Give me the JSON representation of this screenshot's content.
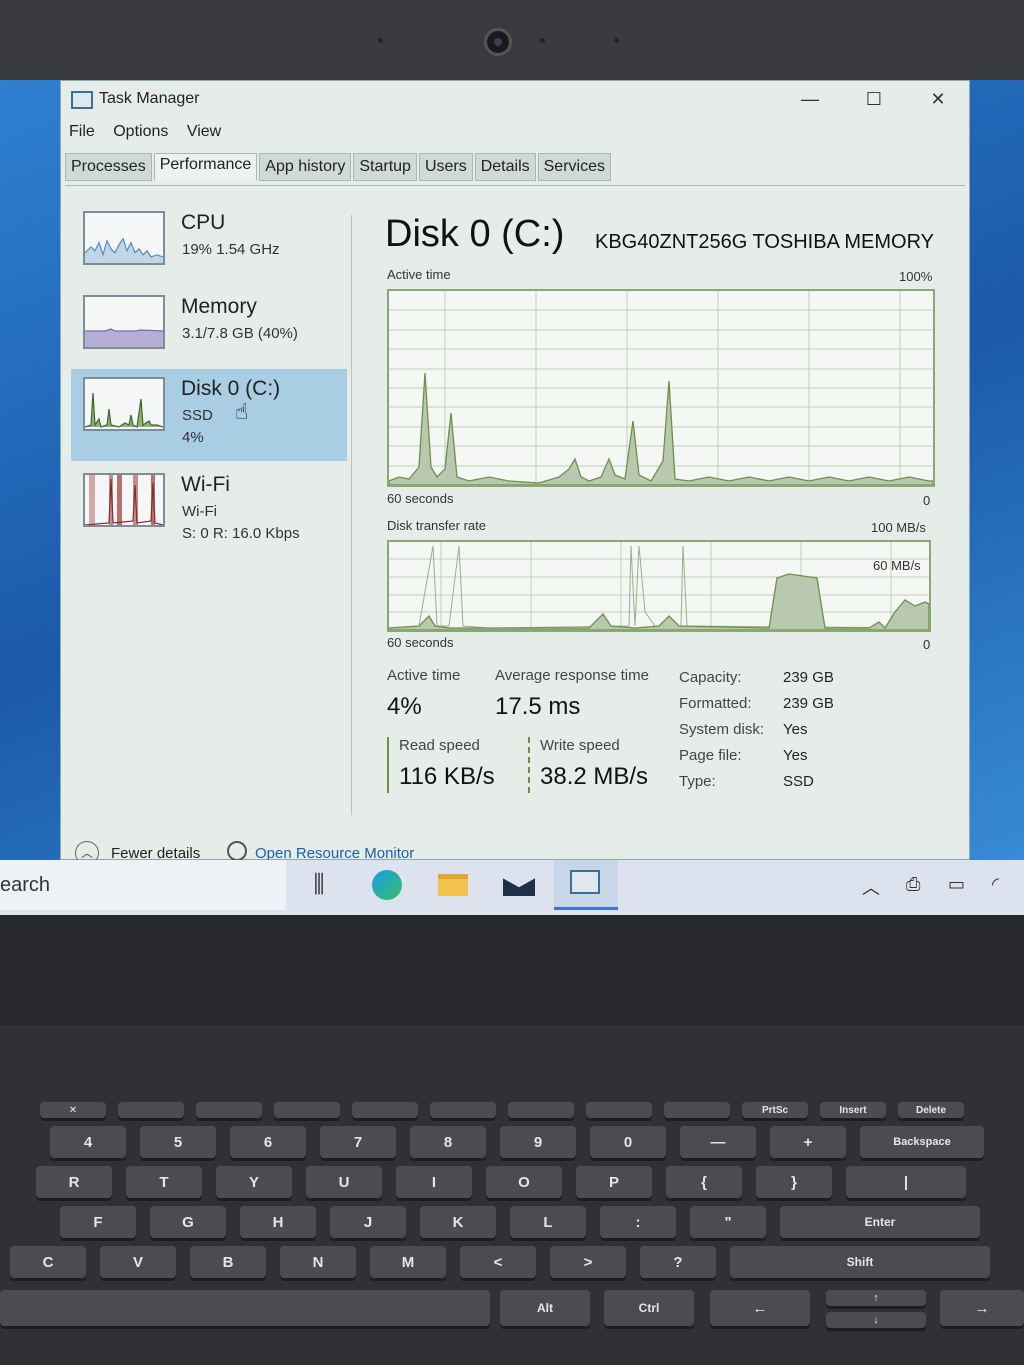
{
  "window": {
    "title": "Task Manager",
    "controls": {
      "minimize": "—",
      "maximize": "☐",
      "close": "✕"
    },
    "menu": [
      "File",
      "Options",
      "View"
    ],
    "tabs": [
      "Processes",
      "Performance",
      "App history",
      "Startup",
      "Users",
      "Details",
      "Services"
    ],
    "active_tab": "Performance"
  },
  "sidebar": {
    "items": [
      {
        "title": "CPU",
        "line1": "19%  1.54 GHz",
        "line2": ""
      },
      {
        "title": "Memory",
        "line1": "3.1/7.8 GB (40%)",
        "line2": ""
      },
      {
        "title": "Disk 0 (C:)",
        "line1": "SSD",
        "line2": "4%"
      },
      {
        "title": "Wi-Fi",
        "line1": "Wi-Fi",
        "line2": "S: 0  R: 16.0 Kbps"
      }
    ],
    "selected": "Disk 0 (C:)"
  },
  "disk": {
    "title": "Disk 0 (C:)",
    "model": "KBG40ZNT256G TOSHIBA MEMORY",
    "active_graph": {
      "label": "Active time",
      "max": "100%",
      "xlabel": "60 seconds",
      "min": "0"
    },
    "transfer_graph": {
      "label": "Disk transfer rate",
      "max": "100 MB/s",
      "mid": "60 MB/s",
      "xlabel": "60 seconds",
      "min": "0"
    },
    "stats": {
      "active_time_label": "Active time",
      "active_time": "4%",
      "avg_resp_label": "Average response time",
      "avg_resp": "17.5 ms",
      "read_label": "Read speed",
      "read": "116 KB/s",
      "write_label": "Write speed",
      "write": "38.2 MB/s"
    },
    "properties": [
      {
        "label": "Capacity:",
        "value": "239 GB"
      },
      {
        "label": "Formatted:",
        "value": "239 GB"
      },
      {
        "label": "System disk:",
        "value": "Yes"
      },
      {
        "label": "Page file:",
        "value": "Yes"
      },
      {
        "label": "Type:",
        "value": "SSD"
      }
    ]
  },
  "footer": {
    "fewer_details": "Fewer details",
    "open_resource_monitor": "Open Resource Monitor"
  },
  "taskbar": {
    "search_text": "earch"
  },
  "keyboard": {
    "fn_row": [
      "✕",
      "",
      "",
      "",
      "",
      "",
      "",
      "",
      "",
      "",
      "PrtSc",
      "Insert",
      "Delete"
    ],
    "num_row": [
      "4",
      "5",
      "6",
      "7",
      "8",
      "9",
      "0",
      "—",
      "+",
      "Backspace"
    ],
    "row_r": [
      "R",
      "T",
      "Y",
      "U",
      "I",
      "O",
      "P",
      "{",
      "}",
      "|"
    ],
    "row_f": [
      "F",
      "G",
      "H",
      "J",
      "K",
      "L",
      ":",
      "\"",
      "Enter"
    ],
    "row_c": [
      "C",
      "V",
      "B",
      "N",
      "M",
      "<",
      ">",
      "?",
      "Shift"
    ],
    "row_bottom": [
      "Alt",
      "Ctrl"
    ]
  },
  "colors": {
    "selection": "#a9cde3",
    "graph_line": "#6e8f4a",
    "graph_fill": "#b8c9b0",
    "link": "#1a5fb4"
  }
}
